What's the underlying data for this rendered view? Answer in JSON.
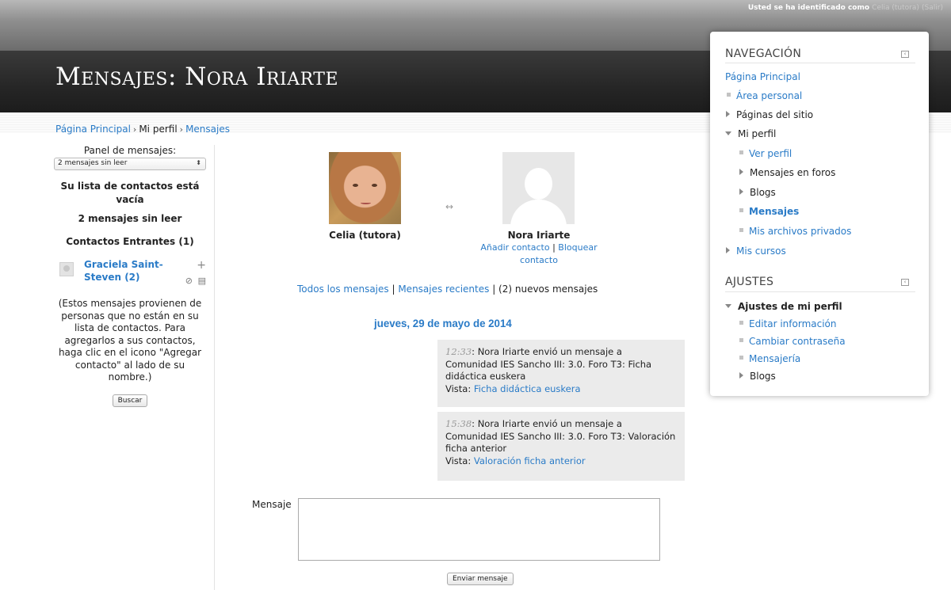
{
  "header": {
    "login_prefix": "Usted se ha identificado como",
    "login_user": "Celia (tutora)",
    "logout_label": "Salir",
    "page_title": "Mensajes: Nora Iriarte"
  },
  "breadcrumb": {
    "home": "Página Principal",
    "profile": "Mi perfil",
    "messages": "Mensajes"
  },
  "left_panel": {
    "title": "Panel de mensajes:",
    "select_value": "2 mensajes sin leer",
    "empty_contacts": "Su lista de contactos está vacía",
    "unread": "2 mensajes sin leer",
    "incoming_title": "Contactos Entrantes (1)",
    "contact_name": "Graciela Saint-Steven (2)",
    "note": "(Estos mensajes provienen de personas que no están en su lista de contactos. Para agregarlos a sus contactos, haga clic en el icono \"Agregar contacto\" al lado de su nombre.)",
    "search_button": "Buscar"
  },
  "conversation": {
    "me_name": "Celia (tutora)",
    "other_name": "Nora Iriarte",
    "add_contact": "Añadir contacto",
    "block_contact": "Bloquear contacto",
    "filter_all": "Todos los mensajes",
    "filter_recent": "Mensajes recientes",
    "filter_new": "(2) nuevos mensajes",
    "date": "jueves, 29 de mayo de 2014",
    "messages": [
      {
        "time": "12:33",
        "text": "Nora Iriarte envió un mensaje a Comunidad IES Sancho III: 3.0. Foro T3: Ficha didáctica euskera",
        "view_label": "Vista:",
        "view_link": "Ficha didáctica euskera"
      },
      {
        "time": "15:38",
        "text": "Nora Iriarte envió un mensaje a Comunidad IES Sancho III: 3.0. Foro T3: Valoración ficha anterior",
        "view_label": "Vista:",
        "view_link": "Valoración ficha anterior"
      }
    ],
    "message_label": "Mensaje",
    "send_button": "Enviar mensaje"
  },
  "navigation": {
    "title": "NAVEGACIÓN",
    "home": "Página Principal",
    "personal_area": "Área personal",
    "site_pages": "Páginas del sitio",
    "my_profile": "Mi perfil",
    "view_profile": "Ver perfil",
    "forum_posts": "Mensajes en foros",
    "blogs": "Blogs",
    "messages": "Mensajes",
    "private_files": "Mis archivos privados",
    "my_courses": "Mis cursos"
  },
  "settings": {
    "title": "AJUSTES",
    "profile_settings": "Ajustes de mi perfil",
    "edit_info": "Editar información",
    "change_password": "Cambiar contraseña",
    "messaging": "Mensajería",
    "blogs": "Blogs"
  },
  "colors": {
    "link": "#2a7bc7",
    "banner": "#262626",
    "message_bg": "#ebebeb"
  }
}
